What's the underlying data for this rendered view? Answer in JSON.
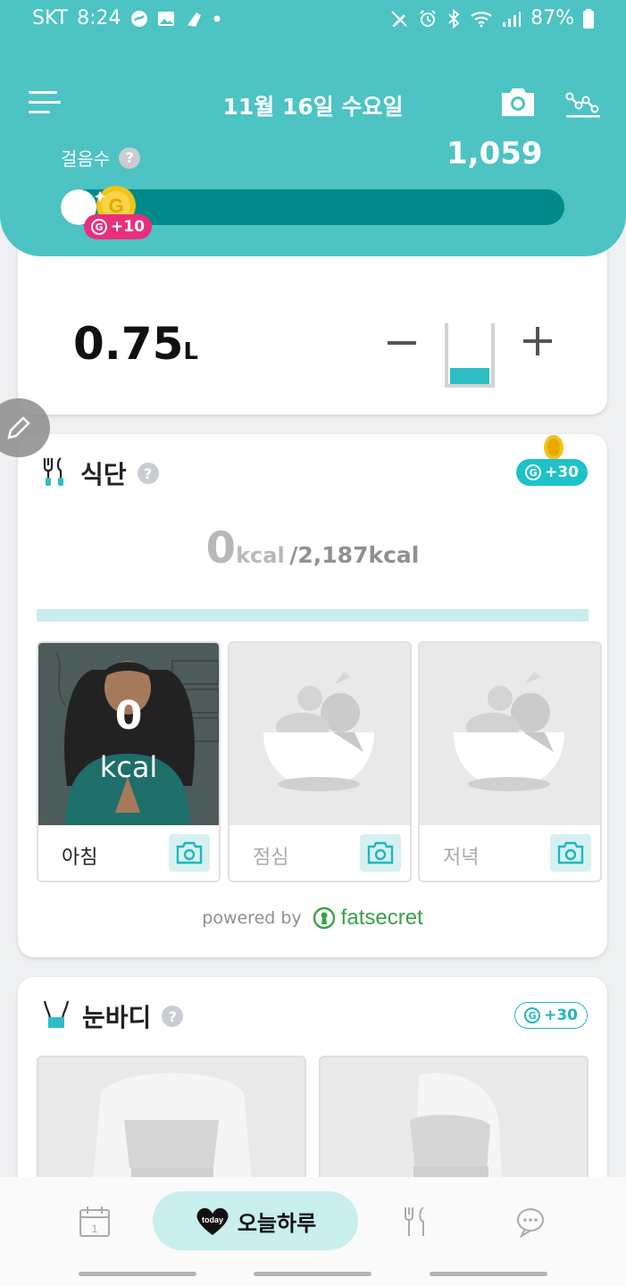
{
  "status_bar": {
    "carrier": "SKT",
    "time": "8:24",
    "battery": "87%",
    "icons_left": [
      "samsung-pay-icon",
      "gallery-icon",
      "shoe-icon",
      "dot-icon"
    ],
    "icons_right": [
      "pen-off-icon",
      "alarm-icon",
      "bluetooth-icon",
      "wifi-icon",
      "signal-icon",
      "battery-icon"
    ]
  },
  "header": {
    "date": "11월 16일 수요일",
    "steps_label": "걸음수",
    "help": "?",
    "steps_value": "1,059",
    "steps_progress": 0.06,
    "reward": "+10",
    "coin_letter": "G"
  },
  "water": {
    "value": "0.75",
    "unit": "L",
    "minus": "−",
    "plus": "+",
    "fill_level": 0.28
  },
  "diet": {
    "title": "식단",
    "help": "?",
    "reward": "+30",
    "kcal_current": "0",
    "kcal_unit": "kcal",
    "kcal_goal": "/2,187kcal",
    "meals": [
      {
        "label": "아침",
        "kcal": "0",
        "kcal_unit": "kcal"
      },
      {
        "label": "점심"
      },
      {
        "label": "저녁"
      }
    ],
    "powered_by": "powered by",
    "brand": "fatsecret"
  },
  "body": {
    "title": "눈바디",
    "help": "?",
    "reward": "+30"
  },
  "bottom_nav": {
    "today_label": "오늘하루",
    "today_badge": "today"
  },
  "colors": {
    "header": "#4dc3c3",
    "progress_track": "#008a8a",
    "accent": "#1ec2c8",
    "reward_pink": "#e8307a",
    "water": "#2ebdc4"
  }
}
